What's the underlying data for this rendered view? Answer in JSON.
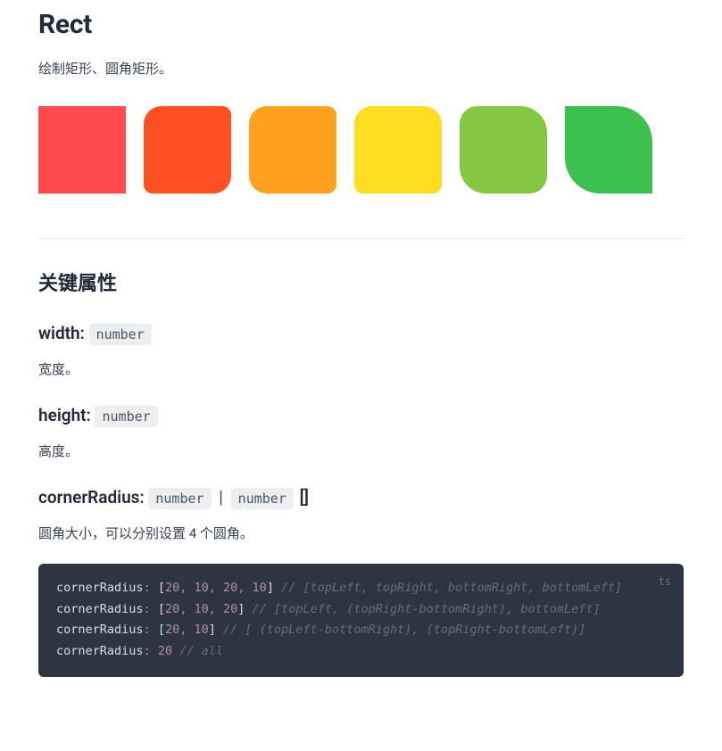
{
  "title": "Rect",
  "intro": "绘制矩形、圆角矩形。",
  "section_title": "关键属性",
  "props": {
    "width": {
      "name": "width:",
      "type": "number",
      "desc": "宽度。"
    },
    "height": {
      "name": "height:",
      "type": "number",
      "desc": "高度。"
    },
    "cornerRadius": {
      "name": "cornerRadius:",
      "type1": "number",
      "pipe": "|",
      "type2": "number",
      "arr": "[]",
      "desc": "圆角大小，可以分别设置 4 个圆角。"
    }
  },
  "code": {
    "lang": "ts",
    "key": "cornerRadius",
    "lines": [
      {
        "nums": [
          "20",
          "10",
          "20",
          "10"
        ],
        "comment": "// [topLeft, topRight, bottomRight, bottomLeft]"
      },
      {
        "nums": [
          "20",
          "10",
          "20"
        ],
        "comment": "// [topLeft, (topRight-bottomRight), bottomLeft]"
      },
      {
        "nums": [
          "20",
          "10"
        ],
        "comment": "// [ (topLeft-bottomRight), (topRight-bottomLeft)]"
      },
      {
        "scalar": "20",
        "comment": "// all"
      }
    ]
  }
}
